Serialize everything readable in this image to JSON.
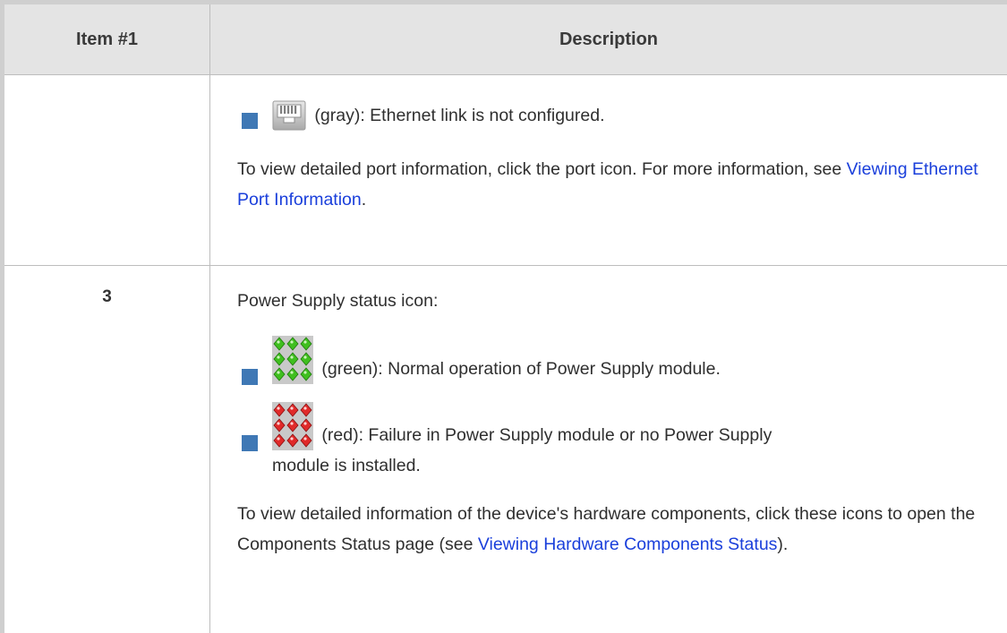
{
  "table": {
    "header": {
      "col1": "Item #1",
      "col2": "Description"
    },
    "row1": {
      "item": "",
      "bullet_gray": "(gray): Ethernet link is not configured.",
      "para_prefix": "To view detailed port information, click the port icon. For more information, see ",
      "para_link": "Viewing Ethernet Port Information",
      "para_suffix": "."
    },
    "row2": {
      "item": "3",
      "intro": "Power Supply status icon:",
      "bullet_green": "(green): Normal operation of Power Supply module.",
      "bullet_red_line1": "(red): Failure in Power Supply module or no Power Supply",
      "bullet_red_line2": "module is installed.",
      "para_prefix": "To view detailed information of the device's hardware components, click these icons to open the Components Status page (see ",
      "para_link": "Viewing Hardware Components Status",
      "para_suffix": ")."
    }
  },
  "icons": {
    "ethernet_port": "ethernet-port-icon",
    "power_green": "power-supply-green-icon",
    "power_red": "power-supply-red-icon",
    "bullet": "square-bullet-icon"
  },
  "colors": {
    "bullet": "#3f78b5",
    "link": "#1a3fdb",
    "header_bg": "#e4e4e4",
    "status_green": "#3fbf1f",
    "status_red": "#e02a2a",
    "port_gray": "#b9b9b9"
  }
}
